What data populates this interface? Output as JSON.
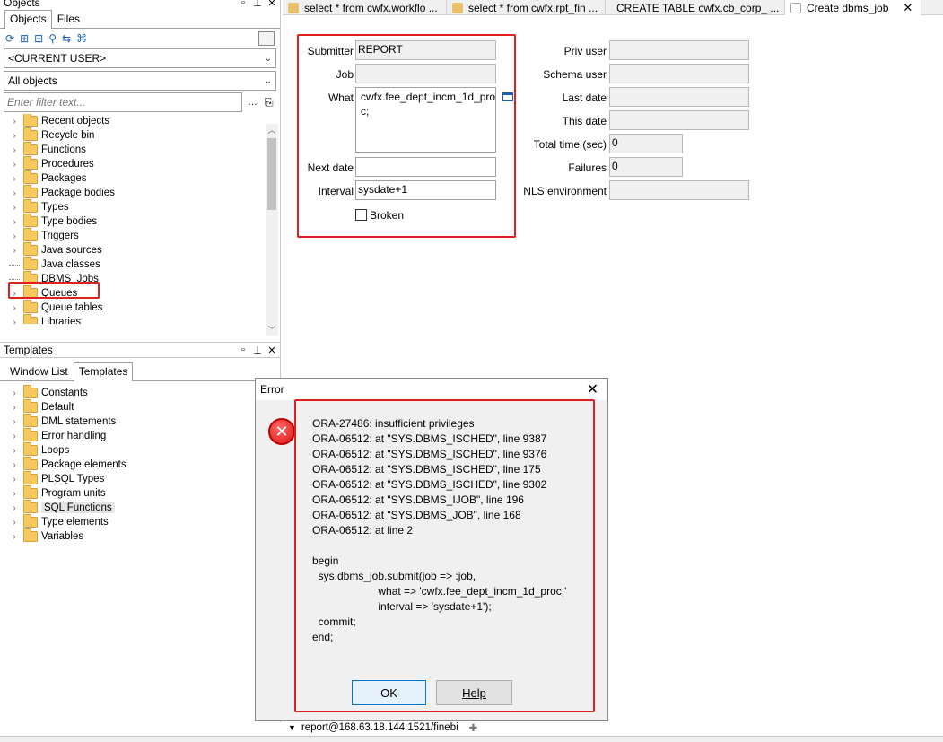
{
  "objects_panel": {
    "title": "Objects",
    "tabs": [
      "Objects",
      "Files"
    ],
    "user_combo": "<CURRENT USER>",
    "scope_combo": "All objects",
    "filter_placeholder": "Enter filter text...",
    "tree": [
      "Recent objects",
      "Recycle bin",
      "Functions",
      "Procedures",
      "Packages",
      "Package bodies",
      "Types",
      "Type bodies",
      "Triggers",
      "Java sources",
      "Java classes",
      "DBMS_Jobs",
      "Queues",
      "Queue tables",
      "Libraries"
    ]
  },
  "templates_panel": {
    "title": "Templates",
    "tabs": [
      "Window List",
      "Templates"
    ],
    "tree": [
      "Constants",
      "Default",
      "DML statements",
      "Error handling",
      "Loops",
      "Package elements",
      "PLSQL Types",
      "Program units",
      "SQL Functions",
      "Type elements",
      "Variables"
    ]
  },
  "doc_tabs": [
    {
      "label": "select * from cwfx.workflo ..."
    },
    {
      "label": "select * from cwfx.rpt_fin ..."
    },
    {
      "label": "CREATE TABLE cwfx.cb_corp_ ..."
    },
    {
      "label": "Create dbms_job"
    }
  ],
  "job_form": {
    "submitter_label": "Submitter",
    "submitter_value": "REPORT",
    "job_label": "Job",
    "job_value": "",
    "what_label": "What",
    "what_value": "cwfx.fee_dept_incm_1d_pro\nc;",
    "next_date_label": "Next date",
    "next_date_value": "",
    "interval_label": "Interval",
    "interval_value": "sysdate+1",
    "broken_label": "Broken",
    "priv_user_label": "Priv user",
    "schema_user_label": "Schema user",
    "last_date_label": "Last date",
    "this_date_label": "This date",
    "total_time_label": "Total time (sec)",
    "total_time_value": "0",
    "failures_label": "Failures",
    "failures_value": "0",
    "nls_label": "NLS environment"
  },
  "error_dialog": {
    "title": "Error",
    "message_lines": [
      "ORA-27486: insufficient privileges",
      "ORA-06512: at \"SYS.DBMS_ISCHED\", line 9387",
      "ORA-06512: at \"SYS.DBMS_ISCHED\", line 9376",
      "ORA-06512: at \"SYS.DBMS_ISCHED\", line 175",
      "ORA-06512: at \"SYS.DBMS_ISCHED\", line 9302",
      "ORA-06512: at \"SYS.DBMS_IJOB\", line 196",
      "ORA-06512: at \"SYS.DBMS_JOB\", line 168",
      "ORA-06512: at line 2",
      "",
      "begin",
      "  sys.dbms_job.submit(job => :job,",
      "                      what => 'cwfx.fee_dept_incm_1d_proc;'",
      "                      interval => 'sysdate+1');",
      "  commit;",
      "end;"
    ],
    "ok_label": "OK",
    "help_label": "Help"
  },
  "status": {
    "connection": "report@168.63.18.144:1521/finebi"
  },
  "colors": {
    "highlight_red": "#e0201e",
    "folder": "#f6c85f"
  }
}
